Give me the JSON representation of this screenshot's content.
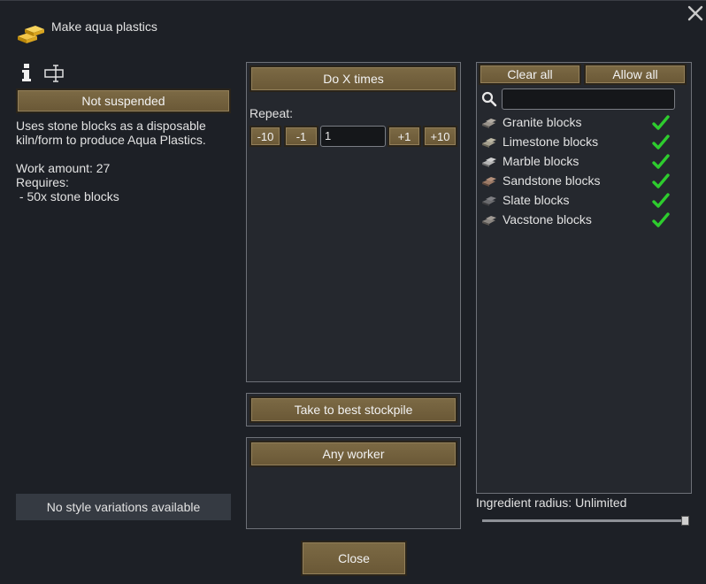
{
  "window": {
    "title": "Make aqua plastics",
    "close_label": "×"
  },
  "left": {
    "suspend_label": "Not suspended",
    "description": "Uses stone blocks as a disposable kiln/form to produce Aqua Plastics.",
    "work_amount": "Work amount: 27",
    "requires_label": "Requires:",
    "requires_item": " - 50x stone blocks",
    "style_label": "No style variations available"
  },
  "middle": {
    "mode_label": "Do X times",
    "repeat_label": "Repeat:",
    "minus10": "-10",
    "minus1": "-1",
    "repeat_value": "1",
    "plus1": "+1",
    "plus10": "+10",
    "store_label": "Take to best stockpile",
    "worker_label": "Any worker"
  },
  "right": {
    "clear_all": "Clear all",
    "allow_all": "Allow all",
    "search_value": "",
    "items": [
      {
        "label": "Granite blocks",
        "icon": "granite-blocks-icon",
        "checked": true
      },
      {
        "label": "Limestone blocks",
        "icon": "limestone-blocks-icon",
        "checked": true
      },
      {
        "label": "Marble blocks",
        "icon": "marble-blocks-icon",
        "checked": true
      },
      {
        "label": "Sandstone blocks",
        "icon": "sandstone-blocks-icon",
        "checked": true
      },
      {
        "label": "Slate blocks",
        "icon": "slate-blocks-icon",
        "checked": true
      },
      {
        "label": "Vacstone blocks",
        "icon": "vacstone-blocks-icon",
        "checked": true
      }
    ],
    "radius_label": "Ingredient radius: Unlimited",
    "radius_fraction": 1.0
  },
  "footer": {
    "close_label": "Close"
  },
  "colors": {
    "button": "#6f5c3a",
    "check": "#2ecc2e",
    "background": "#1d2026"
  }
}
